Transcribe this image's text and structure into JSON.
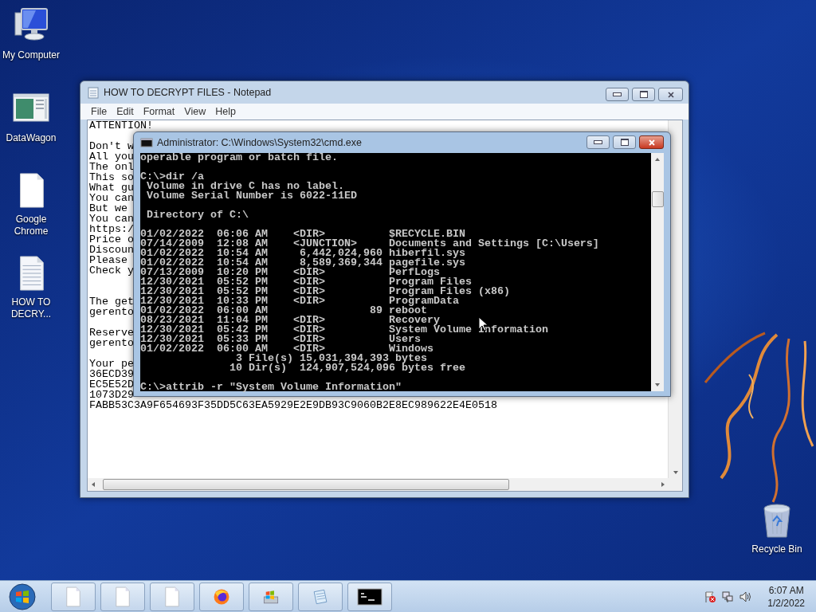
{
  "desktop_icons": [
    {
      "label": "My Computer",
      "kind": "computer"
    },
    {
      "label": "DataWagon",
      "kind": "app"
    },
    {
      "label": "Google Chrome",
      "kind": "file"
    },
    {
      "label": "HOW TO DECRY...",
      "kind": "textfile"
    }
  ],
  "recycle_bin": {
    "label": "Recycle Bin"
  },
  "notepad": {
    "title": "HOW TO DECRYPT FILES - Notepad",
    "menu": [
      "File",
      "Edit",
      "Format",
      "View",
      "Help"
    ],
    "lines": [
      {
        "kind": "text",
        "text": "ATTENTION!"
      },
      {
        "kind": "blank"
      },
      {
        "kind": "text",
        "text": "Don't w"
      },
      {
        "kind": "text",
        "text": "All you"
      },
      {
        "kind": "text",
        "text": "The onl"
      },
      {
        "kind": "text",
        "text": "This so"
      },
      {
        "kind": "text",
        "text": "What gu"
      },
      {
        "kind": "text",
        "text": "You can"
      },
      {
        "kind": "text",
        "text": "But we"
      },
      {
        "kind": "text",
        "text": "You can"
      },
      {
        "kind": "text",
        "text": "https:/"
      },
      {
        "kind": "text",
        "text": "Price o"
      },
      {
        "kind": "text",
        "text": "Discoun"
      },
      {
        "kind": "text",
        "text": "Please"
      },
      {
        "kind": "text",
        "text": "Check y"
      },
      {
        "kind": "blank"
      },
      {
        "kind": "blank"
      },
      {
        "kind": "text",
        "text": "The get"
      },
      {
        "kind": "text",
        "text": "gerento"
      },
      {
        "kind": "blank"
      },
      {
        "kind": "text",
        "text": "Reserve"
      },
      {
        "kind": "text",
        "text": "gerento"
      },
      {
        "kind": "blank"
      },
      {
        "kind": "text",
        "text": "Your pe"
      },
      {
        "kind": "text",
        "text": "36ECD39"
      },
      {
        "kind": "text",
        "text": "EC5E52D"
      },
      {
        "kind": "text",
        "text": "1073D29"
      },
      {
        "kind": "text",
        "text": "FABB53C3A9F654693F35DD5C63EA5929E2E9DB93C9060B2E8EC989622E4E0518"
      }
    ]
  },
  "cmd": {
    "title": "Administrator: C:\\Windows\\System32\\cmd.exe",
    "paragraphs": [
      [
        "operable program or batch file."
      ],
      [
        "C:\\>dir /a",
        " Volume in drive C has no label.",
        " Volume Serial Number is 6022-11ED"
      ],
      [
        " Directory of C:\\"
      ],
      [
        "01/02/2022  06:06 AM    <DIR>          $RECYCLE.BIN",
        "07/14/2009  12:08 AM    <JUNCTION>     Documents and Settings [C:\\Users]",
        "01/02/2022  10:54 AM     6,442,024,960 hiberfil.sys",
        "01/02/2022  10:54 AM     8,589,369,344 pagefile.sys",
        "07/13/2009  10:20 PM    <DIR>          PerfLogs",
        "12/30/2021  05:52 PM    <DIR>          Program Files",
        "12/30/2021  05:52 PM    <DIR>          Program Files (x86)",
        "12/30/2021  10:33 PM    <DIR>          ProgramData",
        "01/02/2022  06:00 AM                89 reboot",
        "08/23/2021  11:04 PM    <DIR>          Recovery",
        "12/30/2021  05:42 PM    <DIR>          System Volume Information",
        "12/30/2021  05:33 PM    <DIR>          Users",
        "01/02/2022  06:00 AM    <DIR>          Windows",
        "               3 File(s) 15,031,394,393 bytes",
        "              10 Dir(s)  124,907,524,096 bytes free"
      ],
      [
        "C:\\>attrib -r \"System Volume Information\""
      ]
    ]
  },
  "taskbar": {
    "buttons": [
      {
        "kind": "file"
      },
      {
        "kind": "file"
      },
      {
        "kind": "file"
      },
      {
        "kind": "browser"
      },
      {
        "kind": "windows-app"
      },
      {
        "kind": "notepad"
      },
      {
        "kind": "console"
      }
    ]
  },
  "clock": {
    "time": "6:07 AM",
    "date": "1/2/2022"
  }
}
